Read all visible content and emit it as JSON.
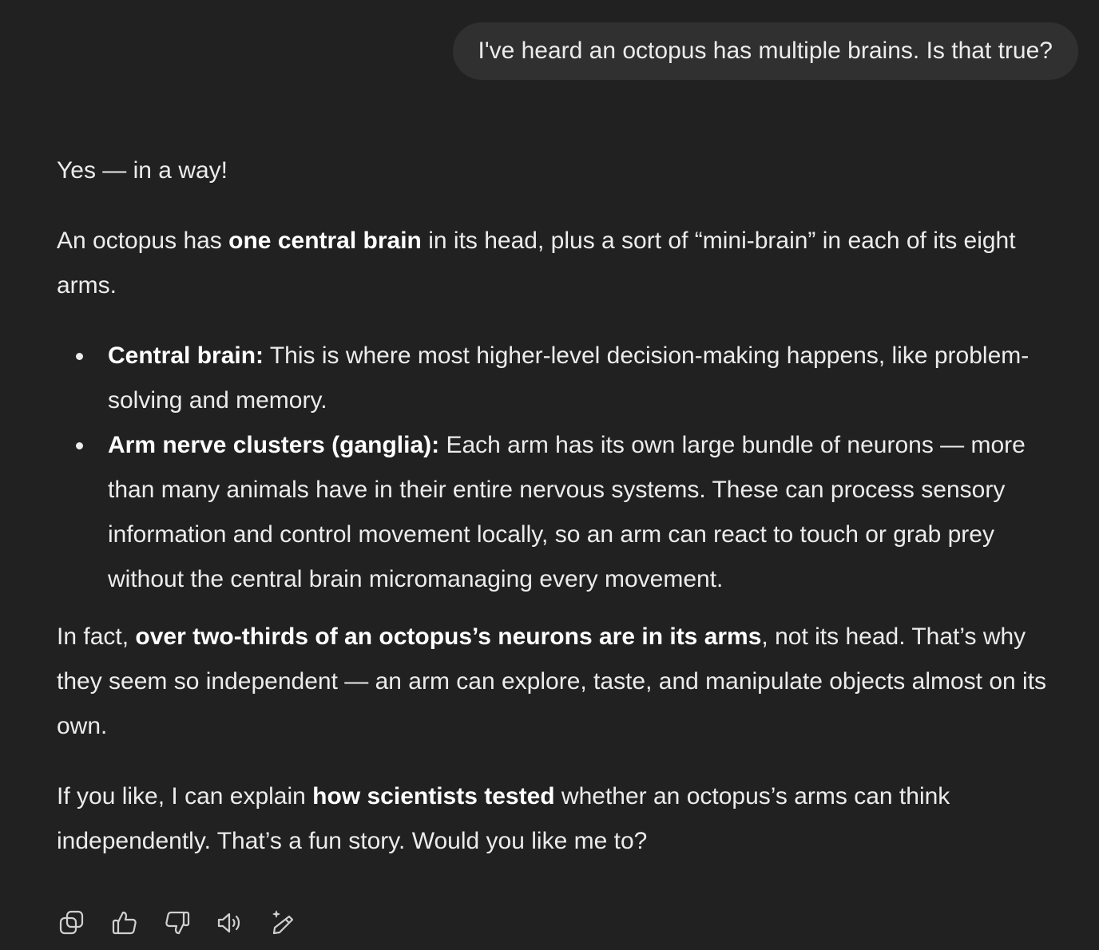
{
  "user_message": "I've heard an octopus has multiple brains. Is that true?",
  "assistant": {
    "yes": "Yes — in a way!",
    "intro": {
      "pre": "An octopus has ",
      "bold": "one central brain",
      "post": " in its head, plus a sort of “mini-brain” in each of its eight arms."
    },
    "bullets": [
      {
        "bold": "Central brain:",
        "text": " This is where most higher-level decision-making happens, like problem-solving and memory."
      },
      {
        "bold": "Arm nerve clusters (ganglia):",
        "text": " Each arm has its own large bundle of neurons — more than many animals have in their entire nervous systems. These can process sensory information and control movement locally, so an arm can react to touch or grab prey without the central brain micromanaging every movement."
      }
    ],
    "fact": {
      "pre": "In fact, ",
      "bold": "over two-thirds of an octopus’s neurons are in its arms",
      "post": ", not its head. That’s why they seem so independent — an arm can explore, taste, and manipulate objects almost on its own."
    },
    "offer": {
      "pre": "If you like, I can explain ",
      "bold": "how scientists tested",
      "post": " whether an octopus’s arms can think independently. That’s a fun story. Would you like me to?"
    }
  },
  "actions": [
    {
      "icon": "copy-icon"
    },
    {
      "icon": "thumbs-up-icon"
    },
    {
      "icon": "thumbs-down-icon"
    },
    {
      "icon": "read-aloud-icon"
    },
    {
      "icon": "edit-sparkle-icon"
    }
  ],
  "colors": {
    "background": "#212121",
    "bubble": "#303030",
    "text": "#ececec"
  }
}
